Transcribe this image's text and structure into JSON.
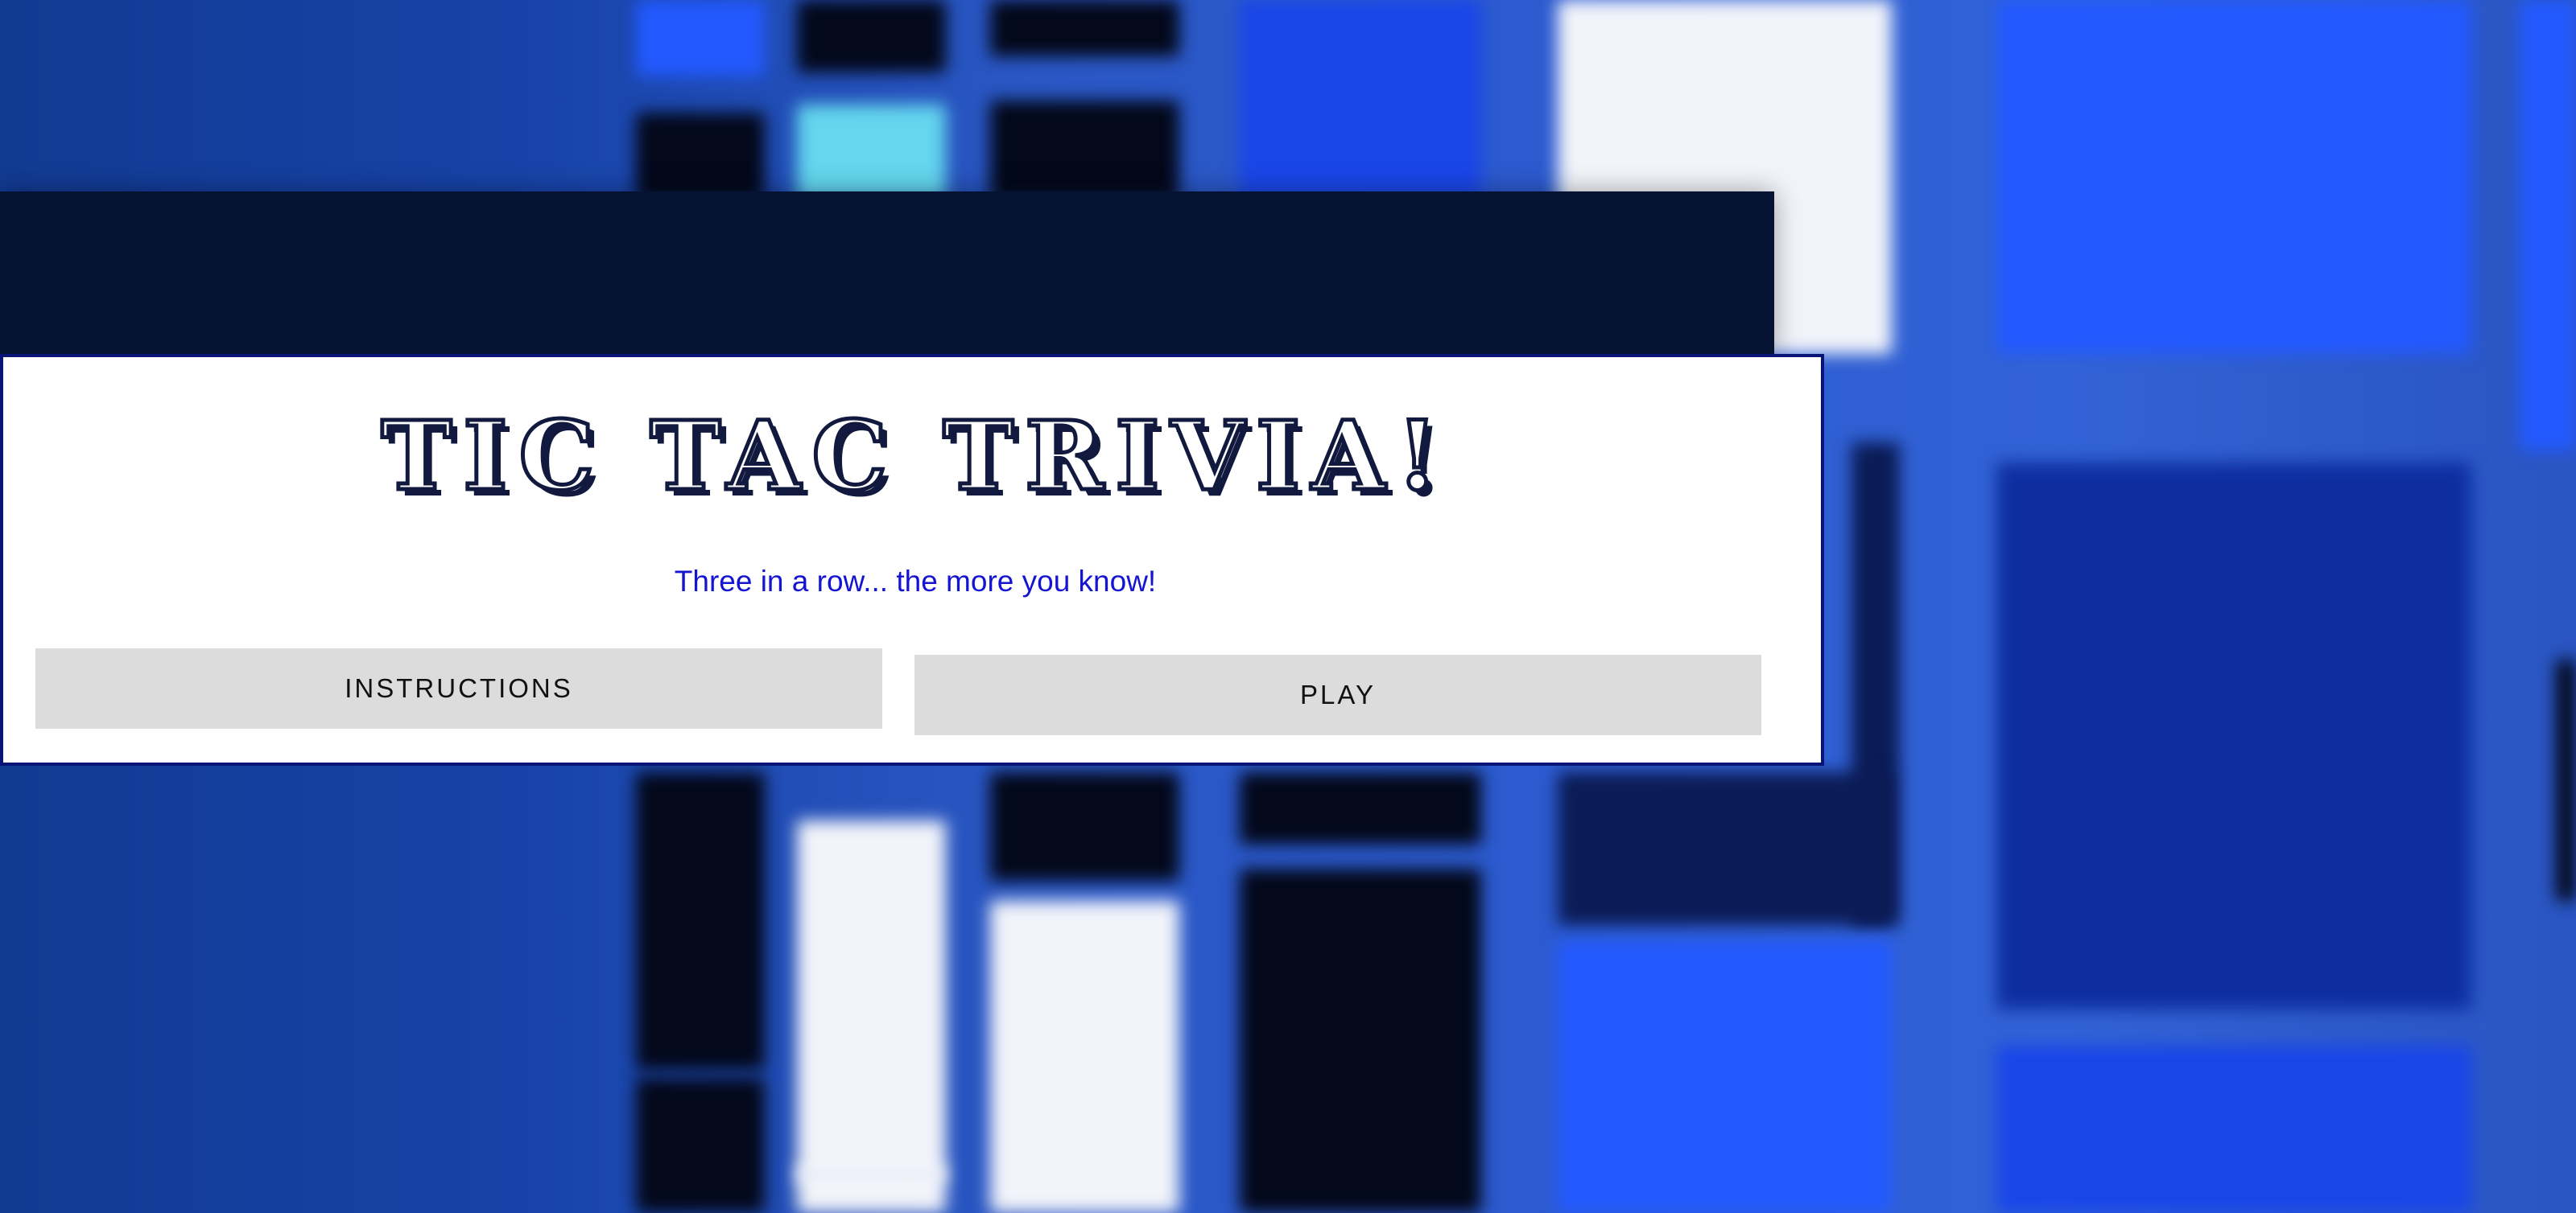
{
  "game": {
    "title": "TIC TAC TRIVIA!",
    "tagline": "Three in a row... the more you know!"
  },
  "menu": {
    "instructions_label": "INSTRUCTIONS",
    "play_label": "PLAY"
  },
  "colors": {
    "panel_border": "#0a1476",
    "title_outline": "#111a3e",
    "tagline": "#1414d2",
    "button_bg": "#dcdcdc",
    "header_strip": "#061231",
    "background": "#123a99"
  }
}
